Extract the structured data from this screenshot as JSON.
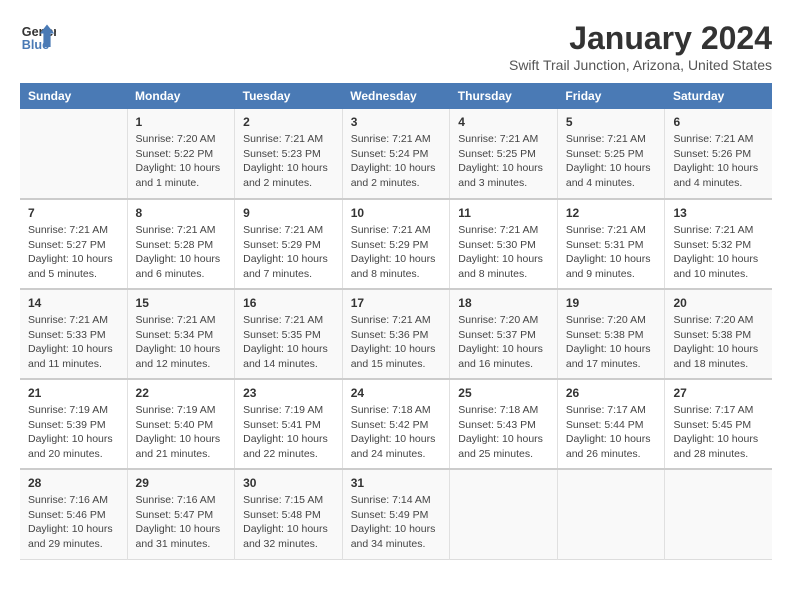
{
  "header": {
    "logo_line1": "General",
    "logo_line2": "Blue",
    "title": "January 2024",
    "subtitle": "Swift Trail Junction, Arizona, United States"
  },
  "columns": [
    "Sunday",
    "Monday",
    "Tuesday",
    "Wednesday",
    "Thursday",
    "Friday",
    "Saturday"
  ],
  "weeks": [
    [
      {
        "day": "",
        "info": ""
      },
      {
        "day": "1",
        "info": "Sunrise: 7:20 AM\nSunset: 5:22 PM\nDaylight: 10 hours\nand 1 minute."
      },
      {
        "day": "2",
        "info": "Sunrise: 7:21 AM\nSunset: 5:23 PM\nDaylight: 10 hours\nand 2 minutes."
      },
      {
        "day": "3",
        "info": "Sunrise: 7:21 AM\nSunset: 5:24 PM\nDaylight: 10 hours\nand 2 minutes."
      },
      {
        "day": "4",
        "info": "Sunrise: 7:21 AM\nSunset: 5:25 PM\nDaylight: 10 hours\nand 3 minutes."
      },
      {
        "day": "5",
        "info": "Sunrise: 7:21 AM\nSunset: 5:25 PM\nDaylight: 10 hours\nand 4 minutes."
      },
      {
        "day": "6",
        "info": "Sunrise: 7:21 AM\nSunset: 5:26 PM\nDaylight: 10 hours\nand 4 minutes."
      }
    ],
    [
      {
        "day": "7",
        "info": "Sunrise: 7:21 AM\nSunset: 5:27 PM\nDaylight: 10 hours\nand 5 minutes."
      },
      {
        "day": "8",
        "info": "Sunrise: 7:21 AM\nSunset: 5:28 PM\nDaylight: 10 hours\nand 6 minutes."
      },
      {
        "day": "9",
        "info": "Sunrise: 7:21 AM\nSunset: 5:29 PM\nDaylight: 10 hours\nand 7 minutes."
      },
      {
        "day": "10",
        "info": "Sunrise: 7:21 AM\nSunset: 5:29 PM\nDaylight: 10 hours\nand 8 minutes."
      },
      {
        "day": "11",
        "info": "Sunrise: 7:21 AM\nSunset: 5:30 PM\nDaylight: 10 hours\nand 8 minutes."
      },
      {
        "day": "12",
        "info": "Sunrise: 7:21 AM\nSunset: 5:31 PM\nDaylight: 10 hours\nand 9 minutes."
      },
      {
        "day": "13",
        "info": "Sunrise: 7:21 AM\nSunset: 5:32 PM\nDaylight: 10 hours\nand 10 minutes."
      }
    ],
    [
      {
        "day": "14",
        "info": "Sunrise: 7:21 AM\nSunset: 5:33 PM\nDaylight: 10 hours\nand 11 minutes."
      },
      {
        "day": "15",
        "info": "Sunrise: 7:21 AM\nSunset: 5:34 PM\nDaylight: 10 hours\nand 12 minutes."
      },
      {
        "day": "16",
        "info": "Sunrise: 7:21 AM\nSunset: 5:35 PM\nDaylight: 10 hours\nand 14 minutes."
      },
      {
        "day": "17",
        "info": "Sunrise: 7:21 AM\nSunset: 5:36 PM\nDaylight: 10 hours\nand 15 minutes."
      },
      {
        "day": "18",
        "info": "Sunrise: 7:20 AM\nSunset: 5:37 PM\nDaylight: 10 hours\nand 16 minutes."
      },
      {
        "day": "19",
        "info": "Sunrise: 7:20 AM\nSunset: 5:38 PM\nDaylight: 10 hours\nand 17 minutes."
      },
      {
        "day": "20",
        "info": "Sunrise: 7:20 AM\nSunset: 5:38 PM\nDaylight: 10 hours\nand 18 minutes."
      }
    ],
    [
      {
        "day": "21",
        "info": "Sunrise: 7:19 AM\nSunset: 5:39 PM\nDaylight: 10 hours\nand 20 minutes."
      },
      {
        "day": "22",
        "info": "Sunrise: 7:19 AM\nSunset: 5:40 PM\nDaylight: 10 hours\nand 21 minutes."
      },
      {
        "day": "23",
        "info": "Sunrise: 7:19 AM\nSunset: 5:41 PM\nDaylight: 10 hours\nand 22 minutes."
      },
      {
        "day": "24",
        "info": "Sunrise: 7:18 AM\nSunset: 5:42 PM\nDaylight: 10 hours\nand 24 minutes."
      },
      {
        "day": "25",
        "info": "Sunrise: 7:18 AM\nSunset: 5:43 PM\nDaylight: 10 hours\nand 25 minutes."
      },
      {
        "day": "26",
        "info": "Sunrise: 7:17 AM\nSunset: 5:44 PM\nDaylight: 10 hours\nand 26 minutes."
      },
      {
        "day": "27",
        "info": "Sunrise: 7:17 AM\nSunset: 5:45 PM\nDaylight: 10 hours\nand 28 minutes."
      }
    ],
    [
      {
        "day": "28",
        "info": "Sunrise: 7:16 AM\nSunset: 5:46 PM\nDaylight: 10 hours\nand 29 minutes."
      },
      {
        "day": "29",
        "info": "Sunrise: 7:16 AM\nSunset: 5:47 PM\nDaylight: 10 hours\nand 31 minutes."
      },
      {
        "day": "30",
        "info": "Sunrise: 7:15 AM\nSunset: 5:48 PM\nDaylight: 10 hours\nand 32 minutes."
      },
      {
        "day": "31",
        "info": "Sunrise: 7:14 AM\nSunset: 5:49 PM\nDaylight: 10 hours\nand 34 minutes."
      },
      {
        "day": "",
        "info": ""
      },
      {
        "day": "",
        "info": ""
      },
      {
        "day": "",
        "info": ""
      }
    ]
  ]
}
